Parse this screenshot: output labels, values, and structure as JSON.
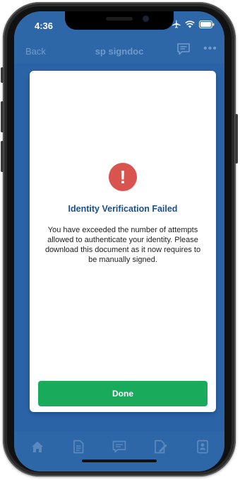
{
  "status_bar": {
    "time": "4:36",
    "icons": [
      "airplane-icon",
      "wifi-icon",
      "battery-icon"
    ]
  },
  "nav": {
    "back_label": "Back",
    "title": "sp signdoc",
    "chat_icon": "chat-icon",
    "more_label": "•••"
  },
  "modal": {
    "icon": "alert-icon",
    "icon_glyph": "!",
    "title": "Identity Verification Failed",
    "message": "You have exceeded the number of attempts allowed to authenticate your identity. Please download this document as it now requires to be manually signed.",
    "done_label": "Done"
  },
  "tab_bar": {
    "items": [
      "home-icon",
      "document-icon",
      "chat-icon",
      "sign-document-icon",
      "contact-card-icon"
    ]
  },
  "colors": {
    "app_blue": "#2d67a8",
    "alert_red": "#d9534f",
    "done_green": "#1aaa5c",
    "title_blue": "#1c4f8a"
  }
}
